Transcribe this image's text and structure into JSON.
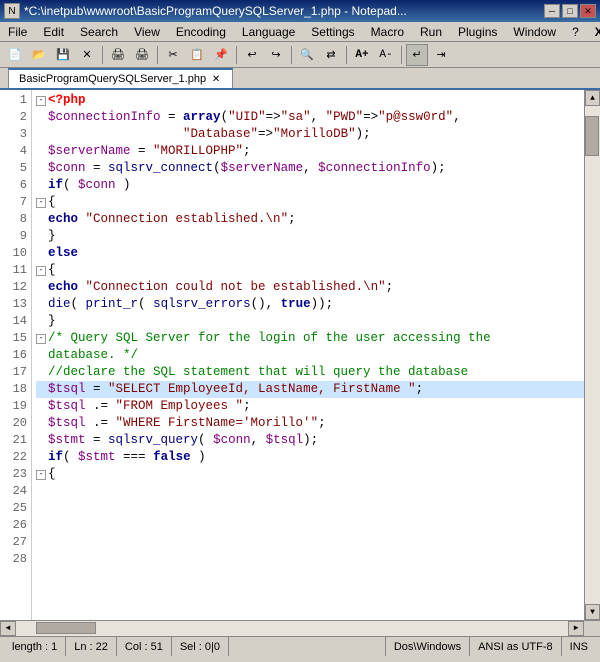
{
  "titleBar": {
    "title": "*C:\\inetpub\\wwwroot\\BasicProgramQuerySQLServer_1.php - Notepad...",
    "buttons": {
      "minimize": "─",
      "maximize": "□",
      "close": "✕"
    }
  },
  "menuBar": {
    "items": [
      "File",
      "Edit",
      "Search",
      "View",
      "Encoding",
      "Language",
      "Settings",
      "Macro",
      "Run",
      "Plugins",
      "Window",
      "?",
      "X"
    ]
  },
  "tabBar": {
    "tab": "BasicProgramQuerySQLServer_1.php"
  },
  "code": {
    "lines": [
      {
        "num": 1,
        "fold": "minus",
        "text": "<?php",
        "type": "phptag"
      },
      {
        "num": 2,
        "fold": null,
        "text": "",
        "type": "plain"
      },
      {
        "num": 3,
        "fold": null,
        "text": "$connectionInfo = array(\"UID\"=>\"sa\", \"PWD\"=>\"p@ssw0rd\",",
        "type": "mixed"
      },
      {
        "num": 4,
        "fold": null,
        "text": "                  \"Database\"=>\"MorilloDB\");",
        "type": "mixed"
      },
      {
        "num": 5,
        "fold": null,
        "text": "$serverName = \"MORILLOPHP\";",
        "type": "mixed"
      },
      {
        "num": 6,
        "fold": null,
        "text": "$conn = sqlsrv_connect($serverName, $connectionInfo);",
        "type": "mixed"
      },
      {
        "num": 7,
        "fold": null,
        "text": "",
        "type": "plain"
      },
      {
        "num": 8,
        "fold": null,
        "text": "if( $conn )",
        "type": "mixed"
      },
      {
        "num": 9,
        "fold": "minus",
        "text": "{",
        "type": "plain"
      },
      {
        "num": 10,
        "fold": null,
        "text": "echo \"Connection established.\\n\";",
        "type": "mixed"
      },
      {
        "num": 11,
        "fold": null,
        "text": "}",
        "type": "plain"
      },
      {
        "num": 12,
        "fold": null,
        "text": "else",
        "type": "kw"
      },
      {
        "num": 13,
        "fold": "minus",
        "text": "{",
        "type": "plain"
      },
      {
        "num": 14,
        "fold": null,
        "text": "echo \"Connection could not be established.\\n\";",
        "type": "mixed"
      },
      {
        "num": 15,
        "fold": null,
        "text": "die( print_r( sqlsrv_errors(), true));",
        "type": "mixed"
      },
      {
        "num": 16,
        "fold": null,
        "text": "}",
        "type": "plain"
      },
      {
        "num": 17,
        "fold": null,
        "text": "",
        "type": "plain"
      },
      {
        "num": 18,
        "fold": "minus",
        "text": "/* Query SQL Server for the login of the user accessing the",
        "type": "comment"
      },
      {
        "num": 19,
        "fold": null,
        "text": "database. */",
        "type": "comment"
      },
      {
        "num": 20,
        "fold": null,
        "text": "",
        "type": "plain"
      },
      {
        "num": 21,
        "fold": null,
        "text": "//declare the SQL statement that will query the database",
        "type": "comment"
      },
      {
        "num": 22,
        "fold": null,
        "text": "$tsql = \"SELECT EmployeeId, LastName, FirstName \";",
        "type": "mixed",
        "highlight": true
      },
      {
        "num": 23,
        "fold": null,
        "text": "$tsql .= \"FROM Employees \";",
        "type": "mixed"
      },
      {
        "num": 24,
        "fold": null,
        "text": "$tsql .= \"WHERE FirstName='Morillo'\";",
        "type": "mixed"
      },
      {
        "num": 25,
        "fold": null,
        "text": "",
        "type": "plain"
      },
      {
        "num": 26,
        "fold": null,
        "text": "$stmt = sqlsrv_query( $conn, $tsql);",
        "type": "mixed"
      },
      {
        "num": 27,
        "fold": null,
        "text": "if( $stmt === false )",
        "type": "mixed"
      },
      {
        "num": 28,
        "fold": "minus",
        "text": "{",
        "type": "plain"
      }
    ]
  },
  "statusBar": {
    "position": "length : 1",
    "line": "Ln : 22",
    "col": "Col : 51",
    "sel": "Sel : 0|0",
    "lineEnding": "Dos\\Windows",
    "encoding": "ANSI as UTF-8",
    "mode": "INS"
  }
}
